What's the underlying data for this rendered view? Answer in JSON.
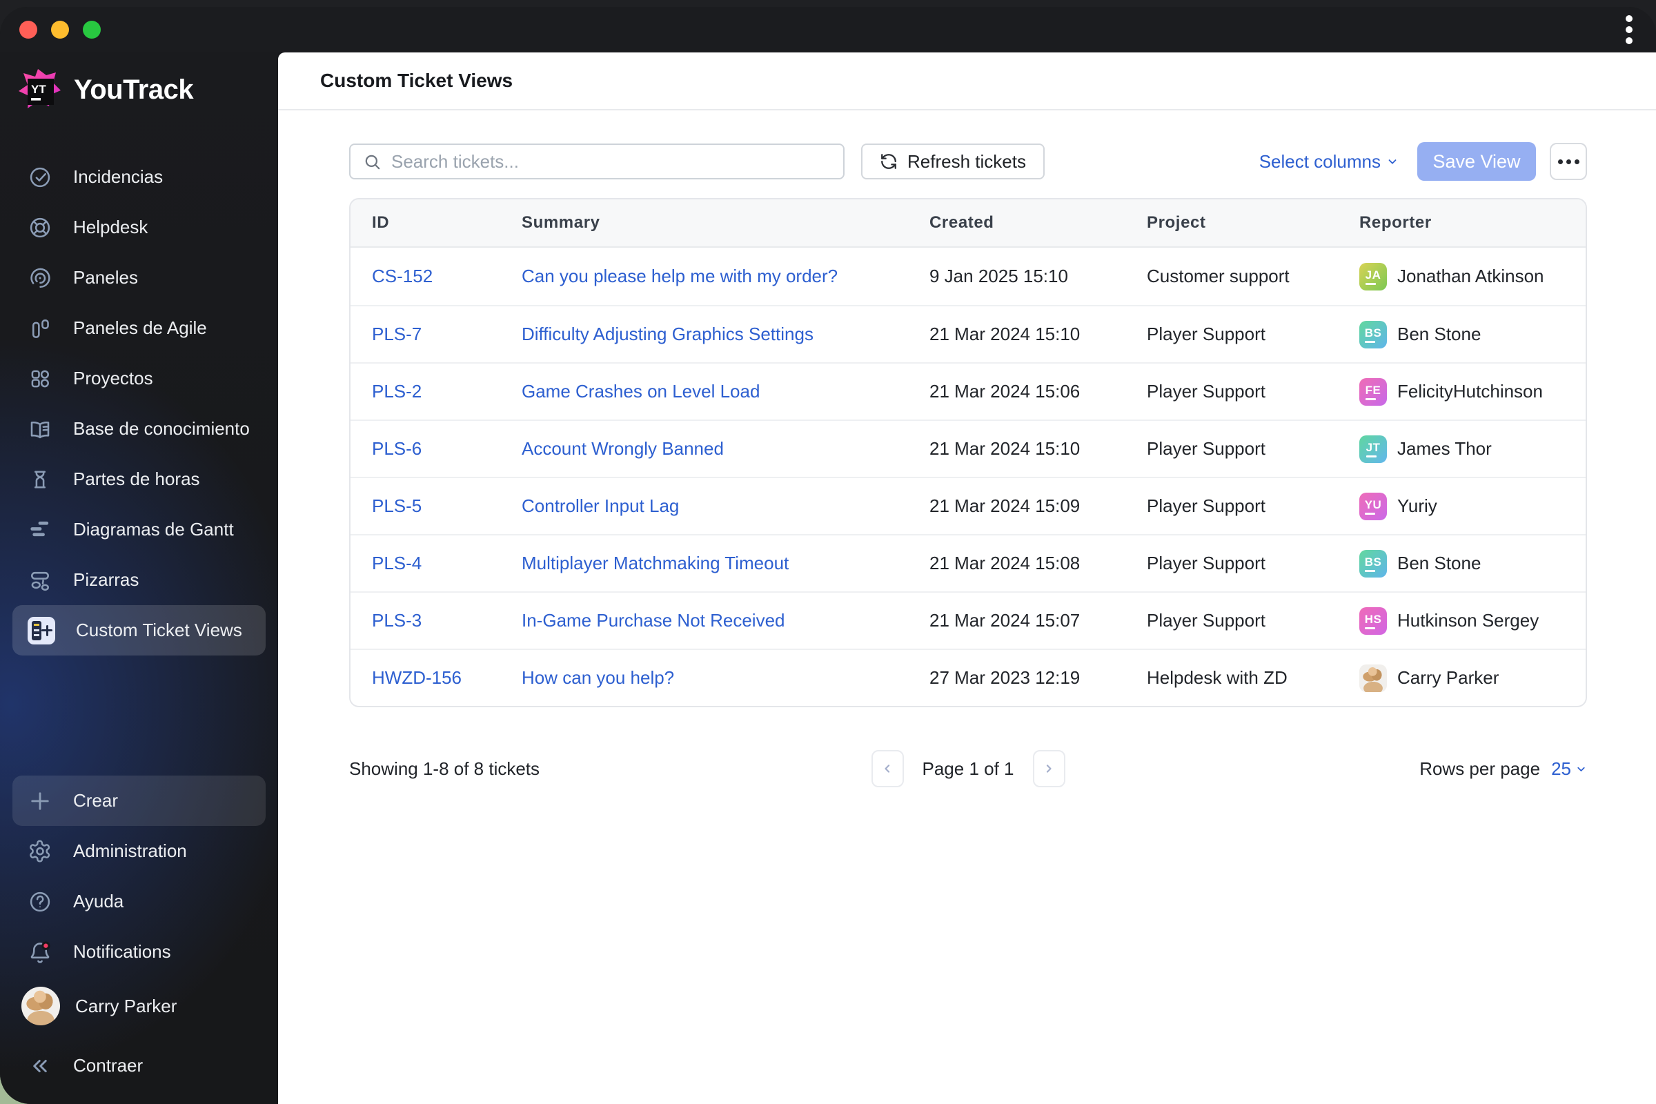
{
  "titlebar": {
    "window_controls": [
      "close",
      "minimize",
      "maximize"
    ],
    "kebab_menu": "more-options"
  },
  "app": {
    "name": "YouTrack",
    "logo_badge": "YT"
  },
  "sidebar": {
    "items": [
      {
        "label": "Incidencias",
        "icon": "issues-check-circle-icon"
      },
      {
        "label": "Helpdesk",
        "icon": "lifebuoy-icon"
      },
      {
        "label": "Paneles",
        "icon": "dashboard-spiral-icon"
      },
      {
        "label": "Paneles de Agile",
        "icon": "agile-board-icon"
      },
      {
        "label": "Proyectos",
        "icon": "projects-grid-icon"
      },
      {
        "label": "Base de conocimiento",
        "icon": "knowledge-book-icon"
      },
      {
        "label": "Partes de horas",
        "icon": "hourglass-icon"
      },
      {
        "label": "Diagramas de Gantt",
        "icon": "gantt-bars-icon"
      },
      {
        "label": "Pizarras",
        "icon": "boards-flowchart-icon"
      },
      {
        "label": "Custom Ticket Views",
        "icon": "custom-ticket-tile-icon",
        "active": true
      }
    ],
    "footer_items": [
      {
        "label": "Crear",
        "icon": "plus-icon",
        "highlighted": true
      },
      {
        "label": "Administration",
        "icon": "gear-icon"
      },
      {
        "label": "Ayuda",
        "icon": "help-circle-icon"
      },
      {
        "label": "Notifications",
        "icon": "bell-icon",
        "has_badge": true
      },
      {
        "label": "Carry Parker",
        "icon": "user-avatar-photo"
      },
      {
        "label": "Contraer",
        "icon": "collapse-chevrons-icon"
      }
    ]
  },
  "header": {
    "title": "Custom Ticket Views"
  },
  "toolbar": {
    "search_placeholder": "Search tickets...",
    "refresh_button": "Refresh tickets",
    "select_columns": "Select columns",
    "save_view": "Save View"
  },
  "table": {
    "columns": [
      "ID",
      "Summary",
      "Created",
      "Project",
      "Reporter"
    ],
    "rows": [
      {
        "id": "CS-152",
        "summary": "Can you please help me with my order?",
        "created": "9 Jan 2025 15:10",
        "project": "Customer support",
        "reporter": {
          "name": "Jonathan Atkinson",
          "initials": "JA",
          "gradient": [
            "#d8d355",
            "#7cc854"
          ]
        }
      },
      {
        "id": "PLS-7",
        "summary": "Difficulty Adjusting Graphics Settings",
        "created": "21 Mar 2024 15:10",
        "project": "Player Support",
        "reporter": {
          "name": "Ben Stone",
          "initials": "BS",
          "gradient": [
            "#62d89e",
            "#5fb5ea"
          ]
        }
      },
      {
        "id": "PLS-2",
        "summary": "Game Crashes on Level Load",
        "created": "21 Mar 2024 15:06",
        "project": "Player Support",
        "reporter": {
          "name": "FelicityHutchinson",
          "initials": "FE",
          "gradient": [
            "#ef6cb5",
            "#c76ae9"
          ]
        }
      },
      {
        "id": "PLS-6",
        "summary": "Account Wrongly Banned",
        "created": "21 Mar 2024 15:10",
        "project": "Player Support",
        "reporter": {
          "name": "James Thor",
          "initials": "JT",
          "gradient": [
            "#5fd6a0",
            "#63b7ec"
          ]
        }
      },
      {
        "id": "PLS-5",
        "summary": "Controller Input Lag",
        "created": "21 Mar 2024 15:09",
        "project": "Player Support",
        "reporter": {
          "name": "Yuriy",
          "initials": "YU",
          "gradient": [
            "#ee6cb8",
            "#cb69e8"
          ]
        }
      },
      {
        "id": "PLS-4",
        "summary": "Multiplayer Matchmaking Timeout",
        "created": "21 Mar 2024 15:08",
        "project": "Player Support",
        "reporter": {
          "name": "Ben Stone",
          "initials": "BS",
          "gradient": [
            "#62d89e",
            "#5fb5ea"
          ]
        }
      },
      {
        "id": "PLS-3",
        "summary": "In-Game Purchase Not Received",
        "created": "21 Mar 2024 15:07",
        "project": "Player Support",
        "reporter": {
          "name": "Hutkinson Sergey",
          "initials": "HS",
          "gradient": [
            "#ef6ab8",
            "#d166e3"
          ]
        }
      },
      {
        "id": "HWZD-156",
        "summary": "How can you help?",
        "created": "27 Mar 2023 12:19",
        "project": "Helpdesk with ZD",
        "reporter": {
          "name": "Carry Parker",
          "photo": true
        }
      }
    ]
  },
  "footer": {
    "showing": "Showing 1-8 of 8 tickets",
    "page": "Page 1 of 1",
    "rows_per_page_label": "Rows per page",
    "rows_per_page_value": "25"
  },
  "colors": {
    "link_blue": "#2d5fd0",
    "save_view_bg": "#96aff2",
    "notification_dot": "#f23b63",
    "traffic_red": "#ff5f57",
    "traffic_yellow": "#febc2e",
    "traffic_green": "#28c840",
    "sidebar_glow": "#26469e",
    "wallpaper_green": "#a3ba96"
  }
}
